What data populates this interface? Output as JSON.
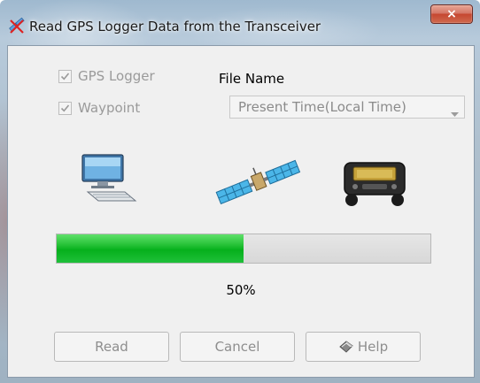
{
  "window": {
    "title": "Read GPS Logger Data from the Transceiver",
    "close_label": "×"
  },
  "options": {
    "gps_logger": {
      "label": "GPS Logger",
      "checked": true,
      "enabled": false
    },
    "waypoint": {
      "label": "Waypoint",
      "checked": true,
      "enabled": false
    }
  },
  "file_name": {
    "label": "File Name",
    "selected": "Present Time(Local Time)"
  },
  "icons": {
    "computer": "computer-icon",
    "satellite": "satellite-icon",
    "transceiver": "transceiver-icon"
  },
  "progress": {
    "value": 0.5,
    "text": "50%"
  },
  "buttons": {
    "read": "Read",
    "cancel": "Cancel",
    "help": "Help"
  },
  "colors": {
    "progress_fill": "#06b01c",
    "close_button": "#c54731"
  }
}
